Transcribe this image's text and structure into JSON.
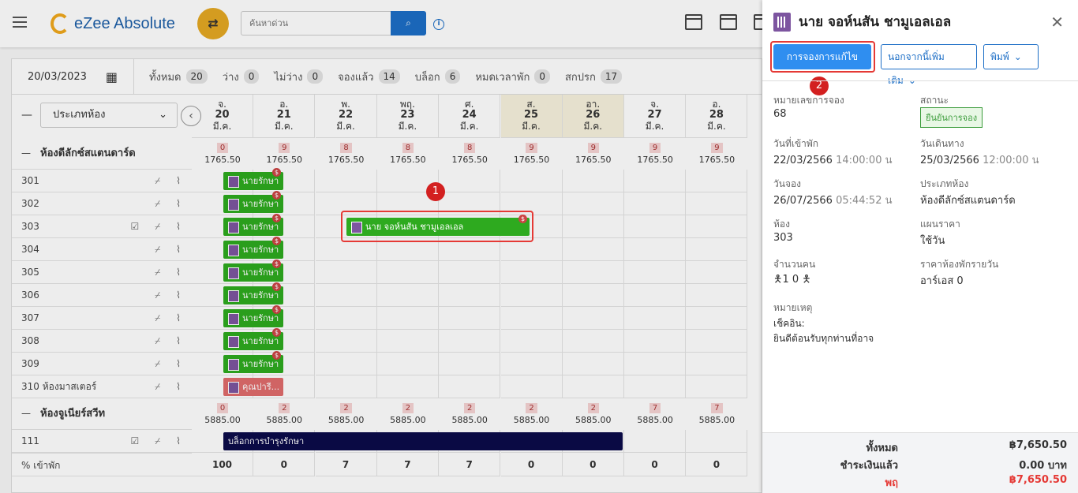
{
  "app": {
    "logo_text": "eZee Absolute",
    "search_placeholder": "ค้นหาด่วน"
  },
  "stats": {
    "date": "20/03/2023",
    "items": [
      {
        "label": "ทั้งหมด",
        "count": "20"
      },
      {
        "label": "ว่าง",
        "count": "0"
      },
      {
        "label": "ไม่ว่าง",
        "count": "0"
      },
      {
        "label": "จองแล้ว",
        "count": "14"
      },
      {
        "label": "บล็อก",
        "count": "6"
      },
      {
        "label": "หมดเวลาพัก",
        "count": "0"
      },
      {
        "label": "สกปรก",
        "count": "17"
      }
    ]
  },
  "room_type_select": "ประเภทห้อง",
  "days": [
    {
      "dow": "จ.",
      "day": "20",
      "mon": "มี.ค."
    },
    {
      "dow": "อ.",
      "day": "21",
      "mon": "มี.ค."
    },
    {
      "dow": "พ.",
      "day": "22",
      "mon": "มี.ค."
    },
    {
      "dow": "พฤ.",
      "day": "23",
      "mon": "มี.ค."
    },
    {
      "dow": "ศ.",
      "day": "24",
      "mon": "มี.ค."
    },
    {
      "dow": "ส.",
      "day": "25",
      "mon": "มี.ค."
    },
    {
      "dow": "อา.",
      "day": "26",
      "mon": "มี.ค."
    },
    {
      "dow": "จ.",
      "day": "27",
      "mon": "มี.ค."
    },
    {
      "dow": "อ.",
      "day": "28",
      "mon": "มี.ค."
    }
  ],
  "room_types": [
    {
      "name": "ห้องดีลักซ์สแตนดาร์ด",
      "avail": [
        "0",
        "9",
        "8",
        "8",
        "8",
        "9",
        "9",
        "9",
        "9"
      ],
      "rate": "1765.50",
      "rooms": [
        "301",
        "302",
        "303",
        "304",
        "305",
        "306",
        "307",
        "308",
        "309",
        "310 ห้องมาสเตอร์"
      ]
    },
    {
      "name": "ห้องจูเนียร์สวีท",
      "avail": [
        "0",
        "2",
        "2",
        "2",
        "2",
        "2",
        "2",
        "7",
        "7"
      ],
      "rate": "5885.00",
      "rooms": [
        "111"
      ]
    }
  ],
  "booking_short": "นายรักษา",
  "booking_pink": "คุณปารี...",
  "highlight_booking": "นาย จอห์นสัน ชามูเอลเอล",
  "block_label": "บล็อกการบำรุงรักษา",
  "occupancy": {
    "label": "% เข้าพัก",
    "values": [
      "100",
      "0",
      "7",
      "7",
      "7",
      "0",
      "0",
      "0",
      "0"
    ]
  },
  "markers": {
    "one": "1",
    "two": "2"
  },
  "panel": {
    "title": "นาย จอห์นสัน ชามูเอลเอล",
    "edit_btn": "การจองการแก้ไข",
    "more_btn": "นอกจากนี้เพิ่มเติม",
    "print_btn": "พิมพ์",
    "f": {
      "res_no_l": "หมายเลขการจอง",
      "res_no": "68",
      "status_l": "สถานะ",
      "status": "ยืนยันการจอง",
      "arr_l": "วันที่เข้าพัก",
      "arr_d": "22/03/2566",
      "arr_t": "14:00:00 น",
      "dep_l": "วันเดินทาง",
      "dep_d": "25/03/2566",
      "dep_t": "12:00:00 น",
      "book_l": "วันจอง",
      "book_d": "26/07/2566",
      "book_t": "05:44:52 น",
      "rt_l": "ประเภทห้อง",
      "rt": "ห้องดีลักซ์สแตนดาร์ด",
      "room_l": "ห้อง",
      "room": "303",
      "plan_l": "แผนราคา",
      "plan": "ใช้วัน",
      "pax_l": "จำนวนคน",
      "pax": "1 0",
      "rate_l": "ราคาห้องพักรายวัน",
      "rate": "อาร์เอส 0",
      "note_l": "หมายเหตุ",
      "note1": "เช็คอิน:",
      "note2": "ยินดีต้อนรับทุกท่านที่อาจ"
    },
    "totals": {
      "total_l": "ทั้งหมด",
      "total": "฿7,650.50",
      "paid_l": "ชำระเงินแล้ว",
      "paid": "0.00 บาท",
      "due_l": "พฤ",
      "due": "฿7,650.50"
    }
  }
}
